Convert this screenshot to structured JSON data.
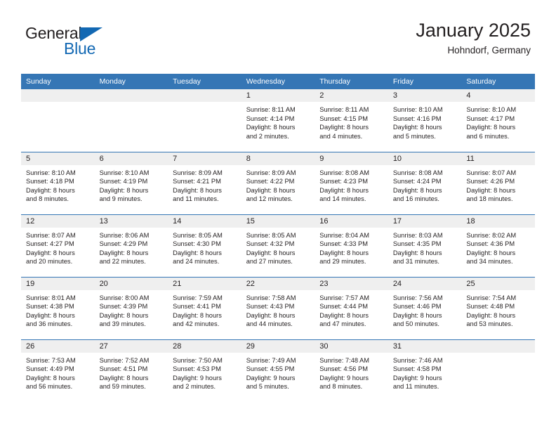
{
  "brand": {
    "name_part1": "General",
    "name_part2": "Blue",
    "triangle_icon": "triangle-icon",
    "accent_color": "#1268b3"
  },
  "header": {
    "title": "January 2025",
    "subtitle": "Hohndorf, Germany"
  },
  "theme": {
    "header_row_bg": "#3576b5",
    "daynum_bg": "#efefef",
    "week_separator": "#3576b5",
    "text": "#231f20"
  },
  "calendar": {
    "weekday_headers": [
      "Sunday",
      "Monday",
      "Tuesday",
      "Wednesday",
      "Thursday",
      "Friday",
      "Saturday"
    ],
    "weeks": [
      [
        {
          "day": "",
          "lines": []
        },
        {
          "day": "",
          "lines": []
        },
        {
          "day": "",
          "lines": []
        },
        {
          "day": "1",
          "lines": [
            "Sunrise: 8:11 AM",
            "Sunset: 4:14 PM",
            "Daylight: 8 hours",
            "and 2 minutes."
          ]
        },
        {
          "day": "2",
          "lines": [
            "Sunrise: 8:11 AM",
            "Sunset: 4:15 PM",
            "Daylight: 8 hours",
            "and 4 minutes."
          ]
        },
        {
          "day": "3",
          "lines": [
            "Sunrise: 8:10 AM",
            "Sunset: 4:16 PM",
            "Daylight: 8 hours",
            "and 5 minutes."
          ]
        },
        {
          "day": "4",
          "lines": [
            "Sunrise: 8:10 AM",
            "Sunset: 4:17 PM",
            "Daylight: 8 hours",
            "and 6 minutes."
          ]
        }
      ],
      [
        {
          "day": "5",
          "lines": [
            "Sunrise: 8:10 AM",
            "Sunset: 4:18 PM",
            "Daylight: 8 hours",
            "and 8 minutes."
          ]
        },
        {
          "day": "6",
          "lines": [
            "Sunrise: 8:10 AM",
            "Sunset: 4:19 PM",
            "Daylight: 8 hours",
            "and 9 minutes."
          ]
        },
        {
          "day": "7",
          "lines": [
            "Sunrise: 8:09 AM",
            "Sunset: 4:21 PM",
            "Daylight: 8 hours",
            "and 11 minutes."
          ]
        },
        {
          "day": "8",
          "lines": [
            "Sunrise: 8:09 AM",
            "Sunset: 4:22 PM",
            "Daylight: 8 hours",
            "and 12 minutes."
          ]
        },
        {
          "day": "9",
          "lines": [
            "Sunrise: 8:08 AM",
            "Sunset: 4:23 PM",
            "Daylight: 8 hours",
            "and 14 minutes."
          ]
        },
        {
          "day": "10",
          "lines": [
            "Sunrise: 8:08 AM",
            "Sunset: 4:24 PM",
            "Daylight: 8 hours",
            "and 16 minutes."
          ]
        },
        {
          "day": "11",
          "lines": [
            "Sunrise: 8:07 AM",
            "Sunset: 4:26 PM",
            "Daylight: 8 hours",
            "and 18 minutes."
          ]
        }
      ],
      [
        {
          "day": "12",
          "lines": [
            "Sunrise: 8:07 AM",
            "Sunset: 4:27 PM",
            "Daylight: 8 hours",
            "and 20 minutes."
          ]
        },
        {
          "day": "13",
          "lines": [
            "Sunrise: 8:06 AM",
            "Sunset: 4:29 PM",
            "Daylight: 8 hours",
            "and 22 minutes."
          ]
        },
        {
          "day": "14",
          "lines": [
            "Sunrise: 8:05 AM",
            "Sunset: 4:30 PM",
            "Daylight: 8 hours",
            "and 24 minutes."
          ]
        },
        {
          "day": "15",
          "lines": [
            "Sunrise: 8:05 AM",
            "Sunset: 4:32 PM",
            "Daylight: 8 hours",
            "and 27 minutes."
          ]
        },
        {
          "day": "16",
          "lines": [
            "Sunrise: 8:04 AM",
            "Sunset: 4:33 PM",
            "Daylight: 8 hours",
            "and 29 minutes."
          ]
        },
        {
          "day": "17",
          "lines": [
            "Sunrise: 8:03 AM",
            "Sunset: 4:35 PM",
            "Daylight: 8 hours",
            "and 31 minutes."
          ]
        },
        {
          "day": "18",
          "lines": [
            "Sunrise: 8:02 AM",
            "Sunset: 4:36 PM",
            "Daylight: 8 hours",
            "and 34 minutes."
          ]
        }
      ],
      [
        {
          "day": "19",
          "lines": [
            "Sunrise: 8:01 AM",
            "Sunset: 4:38 PM",
            "Daylight: 8 hours",
            "and 36 minutes."
          ]
        },
        {
          "day": "20",
          "lines": [
            "Sunrise: 8:00 AM",
            "Sunset: 4:39 PM",
            "Daylight: 8 hours",
            "and 39 minutes."
          ]
        },
        {
          "day": "21",
          "lines": [
            "Sunrise: 7:59 AM",
            "Sunset: 4:41 PM",
            "Daylight: 8 hours",
            "and 42 minutes."
          ]
        },
        {
          "day": "22",
          "lines": [
            "Sunrise: 7:58 AM",
            "Sunset: 4:43 PM",
            "Daylight: 8 hours",
            "and 44 minutes."
          ]
        },
        {
          "day": "23",
          "lines": [
            "Sunrise: 7:57 AM",
            "Sunset: 4:44 PM",
            "Daylight: 8 hours",
            "and 47 minutes."
          ]
        },
        {
          "day": "24",
          "lines": [
            "Sunrise: 7:56 AM",
            "Sunset: 4:46 PM",
            "Daylight: 8 hours",
            "and 50 minutes."
          ]
        },
        {
          "day": "25",
          "lines": [
            "Sunrise: 7:54 AM",
            "Sunset: 4:48 PM",
            "Daylight: 8 hours",
            "and 53 minutes."
          ]
        }
      ],
      [
        {
          "day": "26",
          "lines": [
            "Sunrise: 7:53 AM",
            "Sunset: 4:49 PM",
            "Daylight: 8 hours",
            "and 56 minutes."
          ]
        },
        {
          "day": "27",
          "lines": [
            "Sunrise: 7:52 AM",
            "Sunset: 4:51 PM",
            "Daylight: 8 hours",
            "and 59 minutes."
          ]
        },
        {
          "day": "28",
          "lines": [
            "Sunrise: 7:50 AM",
            "Sunset: 4:53 PM",
            "Daylight: 9 hours",
            "and 2 minutes."
          ]
        },
        {
          "day": "29",
          "lines": [
            "Sunrise: 7:49 AM",
            "Sunset: 4:55 PM",
            "Daylight: 9 hours",
            "and 5 minutes."
          ]
        },
        {
          "day": "30",
          "lines": [
            "Sunrise: 7:48 AM",
            "Sunset: 4:56 PM",
            "Daylight: 9 hours",
            "and 8 minutes."
          ]
        },
        {
          "day": "31",
          "lines": [
            "Sunrise: 7:46 AM",
            "Sunset: 4:58 PM",
            "Daylight: 9 hours",
            "and 11 minutes."
          ]
        },
        {
          "day": "",
          "lines": []
        }
      ]
    ]
  }
}
